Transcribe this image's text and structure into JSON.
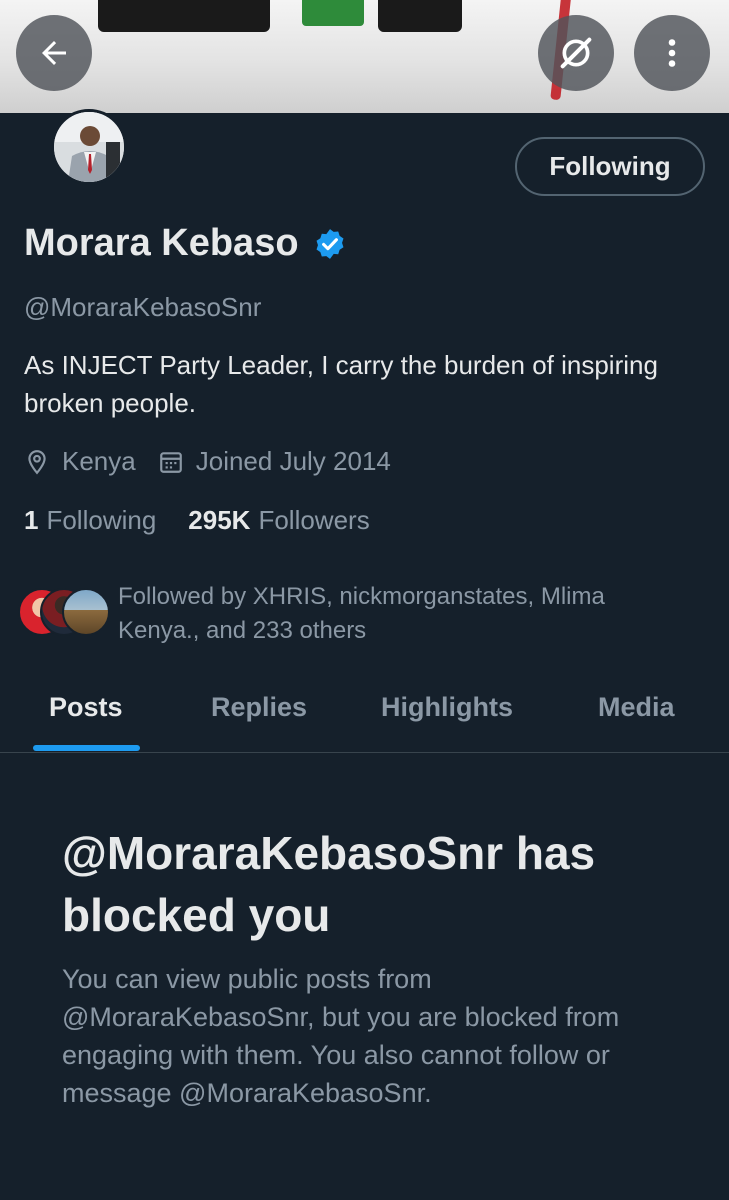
{
  "header": {
    "back_icon": "arrow-left-icon",
    "grok_icon": "grok-icon",
    "more_icon": "more-vertical-icon"
  },
  "profile": {
    "follow_button": "Following",
    "name": "Morara Kebaso",
    "verified": true,
    "handle": "@MoraraKebasoSnr",
    "bio": "As INJECT Party Leader, I carry the burden of inspiring broken people.",
    "location": "Kenya",
    "joined": "Joined July 2014",
    "following_count": "1",
    "following_label": "Following",
    "followers_count": "295K",
    "followers_label": "Followers",
    "followed_by": "Followed by XHRIS, nickmorganstates, Mlima Kenya., and 233 others"
  },
  "tabs": [
    {
      "label": "Posts",
      "active": true
    },
    {
      "label": "Replies",
      "active": false
    },
    {
      "label": "Highlights",
      "active": false
    },
    {
      "label": "Media",
      "active": false
    }
  ],
  "blocked": {
    "title": "@MoraraKebasoSnr has blocked you",
    "message": "You can view public posts from @MoraraKebasoSnr, but you are blocked from engaging with them. You also cannot follow or message @MoraraKebasoSnr."
  },
  "colors": {
    "background": "#15202b",
    "accent": "#1d9bf0",
    "secondary_text": "#8b98a5"
  }
}
